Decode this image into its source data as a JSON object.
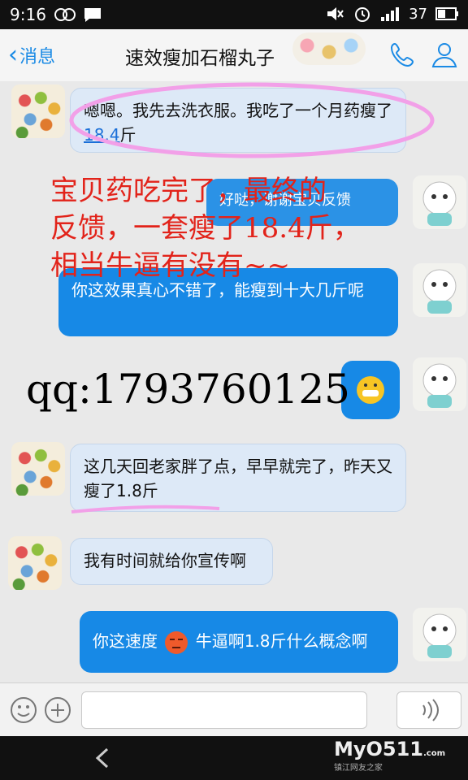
{
  "status_bar": {
    "time": "9:16",
    "battery": "37"
  },
  "header": {
    "back_label": "消息",
    "title": "速效瘦加石榴丸子"
  },
  "messages": [
    {
      "text": "嗯嗯。我先去洗衣服。我吃了一个月药瘦了",
      "link": "18.4",
      "suffix": "斤"
    },
    {
      "text": "你这效果真心不错了，能瘦到十大几斤呢"
    },
    {
      "text": "这几天回老家胖了点，早早就完了，昨天又瘦了1.8斤"
    },
    {
      "text": "我有时间就给你宣传啊"
    },
    {
      "text_a": "你这速度",
      "text_b": "牛逼啊1.8斤什么概念啊"
    }
  ],
  "overlay_red": {
    "line1": "宝贝药吃完了，最终的",
    "line2": "反馈，一套瘦了18.4斤，",
    "line3": "相当牛逼有没有~~"
  },
  "overlay_qq": "qq:1793760125",
  "hidden_bubble_text": "好哒，谢谢宝贝反馈",
  "watermark": {
    "main": "MyO511",
    "sub": "镇江网友之家",
    ".com": ".com"
  },
  "colors": {
    "bubble_out": "#1789e6",
    "bubble_in": "#dde9f7",
    "overlay_red": "#e2231a",
    "accent": "#1a8ae5"
  }
}
